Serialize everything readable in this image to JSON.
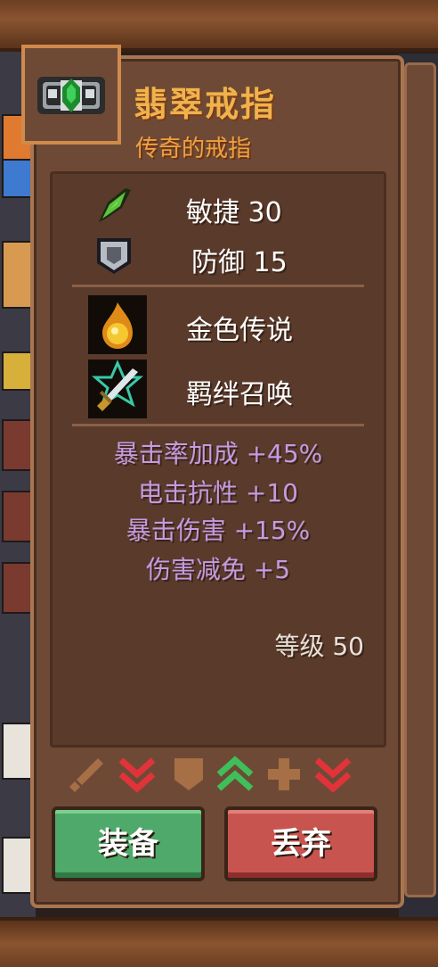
{
  "item": {
    "name": "翡翠戒指",
    "subtitle": "传奇的戒指",
    "icon": "emerald-ring-icon"
  },
  "stats": [
    {
      "icon": "leaf-icon",
      "label": "敏捷 30"
    },
    {
      "icon": "shield-icon",
      "label": "防御 15"
    }
  ],
  "traits": [
    {
      "icon": "golden-flame-icon",
      "label": "金色传说"
    },
    {
      "icon": "sword-summon-icon",
      "label": "羁绊召唤"
    }
  ],
  "bonuses": [
    "暴击率加成 +45%",
    "电击抗性 +10",
    "暴击伤害 +15%",
    "伤害减免 +5"
  ],
  "level_text": "等级 50",
  "compare": [
    {
      "icon": "sword-icon",
      "state": "neutral"
    },
    {
      "icon": "double-down-arrow-icon",
      "state": "down"
    },
    {
      "icon": "shield-icon",
      "state": "neutral"
    },
    {
      "icon": "double-up-arrow-icon",
      "state": "up"
    },
    {
      "icon": "plus-icon",
      "state": "neutral"
    },
    {
      "icon": "double-down-arrow-icon",
      "state": "down"
    }
  ],
  "buttons": {
    "equip": "装备",
    "drop": "丢弃"
  },
  "colors": {
    "title": "#f0b24a",
    "bonus": "#c49be0",
    "equip": "#4ea96a",
    "drop": "#c85450",
    "down": "#e0333a",
    "up": "#3fbf5a"
  }
}
